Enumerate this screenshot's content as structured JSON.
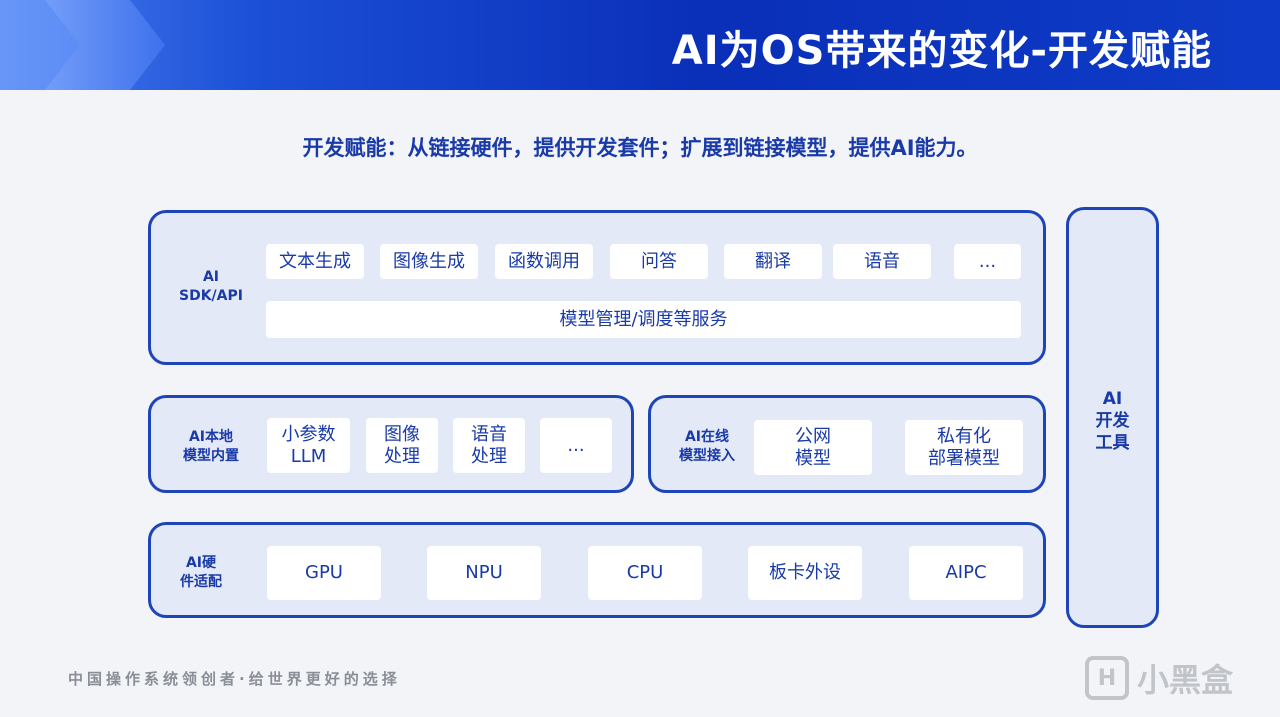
{
  "header": {
    "title": "AI为OS带来的变化-开发赋能"
  },
  "subtitle": "开发赋能：从链接硬件，提供开发套件；扩展到链接模型，提供AI能力。",
  "sdk_panel": {
    "label_line1": "AI",
    "label_line2": "SDK/API",
    "chips": [
      "文本生成",
      "图像生成",
      "函数调用",
      "问答",
      "翻译",
      "语音",
      "..."
    ],
    "service_bar": "模型管理/调度等服务"
  },
  "local_panel": {
    "label_line1": "AI本地",
    "label_line2": "模型内置",
    "chips": [
      {
        "line1": "小参数",
        "line2": "LLM"
      },
      {
        "line1": "图像",
        "line2": "处理"
      },
      {
        "line1": "语音",
        "line2": "处理"
      },
      {
        "line1": "...",
        "line2": ""
      }
    ]
  },
  "online_panel": {
    "label_line1": "AI在线",
    "label_line2": "模型接入",
    "chips": [
      {
        "line1": "公网",
        "line2": "模型"
      },
      {
        "line1": "私有化",
        "line2": "部署模型"
      }
    ]
  },
  "hardware_panel": {
    "label_line1": "AI硬",
    "label_line2": "件适配",
    "chips": [
      "GPU",
      "NPU",
      "CPU",
      "板卡外设",
      "AIPC"
    ]
  },
  "tools_panel": {
    "line1": "AI",
    "line2": "开发",
    "line3": "工具"
  },
  "footer": {
    "slogan": "中国操作系统领创者·给世界更好的选择"
  },
  "watermark": {
    "text": "小黑盒"
  },
  "colors": {
    "accent": "#1e45b8",
    "header_blue": "#0a2fb8",
    "panel_fill": "#e3e9f6"
  }
}
